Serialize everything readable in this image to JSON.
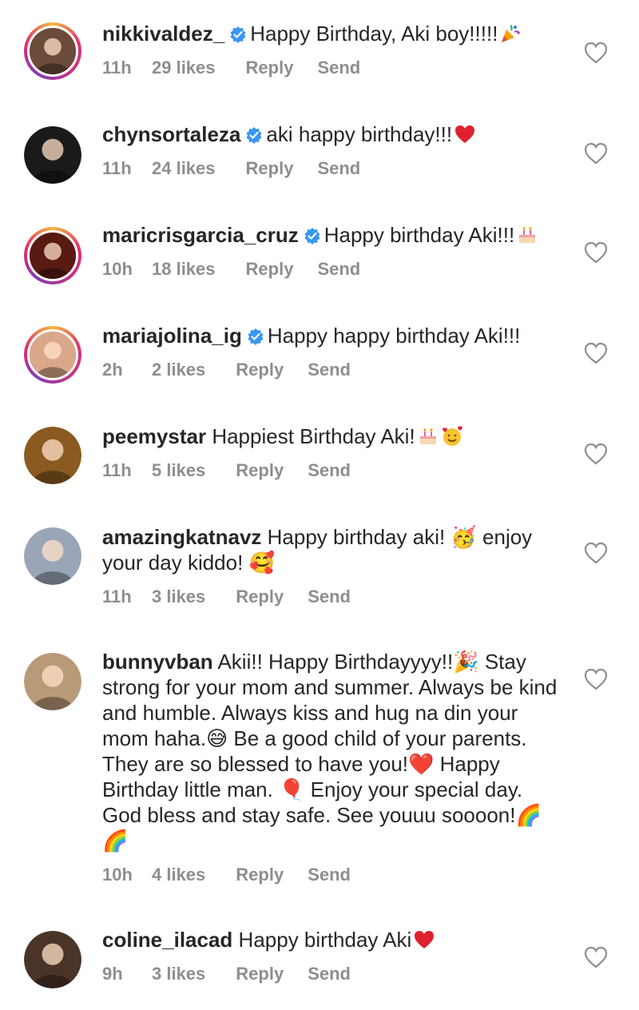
{
  "comments": [
    {
      "username": "nikkivaldez_",
      "verified": true,
      "text": "Happy Birthday, Aki boy!!!!!",
      "emoji": [
        "party-popper"
      ],
      "time": "11h",
      "likes": "29 likes",
      "reply": "Reply",
      "send": "Send",
      "story_ring": true,
      "avatar_color": "#6b4b3a"
    },
    {
      "username": "chynsortaleza",
      "verified": true,
      "text": "aki happy birthday!!!",
      "emoji": [
        "red-heart"
      ],
      "time": "11h",
      "likes": "24 likes",
      "reply": "Reply",
      "send": "Send",
      "story_ring": false,
      "avatar_color": "#1a1a1a"
    },
    {
      "username": "maricrisgarcia_cruz",
      "verified": true,
      "text": "Happy birthday Aki!!!",
      "emoji": [
        "birthday-cake"
      ],
      "time": "10h",
      "likes": "18 likes",
      "reply": "Reply",
      "send": "Send",
      "story_ring": true,
      "avatar_color": "#5a1a14"
    },
    {
      "username": "mariajolina_ig",
      "verified": true,
      "text": "Happy happy birthday Aki!!!",
      "emoji": [],
      "time": "2h",
      "likes": "2 likes",
      "reply": "Reply",
      "send": "Send",
      "story_ring": true,
      "avatar_color": "#d9a88a"
    },
    {
      "username": "peemystar",
      "verified": false,
      "text": "Happiest Birthday Aki!",
      "emoji": [
        "birthday-cake",
        "smiling-face-with-hearts"
      ],
      "time": "11h",
      "likes": "5 likes",
      "reply": "Reply",
      "send": "Send",
      "story_ring": false,
      "avatar_color": "#8a5a20"
    },
    {
      "username": "amazingkatnavz",
      "verified": false,
      "text": "Happy birthday aki! 🥳 enjoy your day kiddo! 🥰",
      "emoji": [],
      "time": "11h",
      "likes": "3 likes",
      "reply": "Reply",
      "send": "Send",
      "story_ring": false,
      "avatar_color": "#9aa6b8"
    },
    {
      "username": "bunnyvban",
      "verified": false,
      "text": "Akii!! Happy Birthdayyyy!!🎉 Stay strong for your mom and summer. Always be kind and humble. Always kiss and hug na din your mom haha.😅 Be a good child of your parents. They are so blessed to have you!❤️ Happy Birthday little man. 🎈 Enjoy your special day. God bless and stay safe. See youuu soooon!🌈🌈",
      "emoji": [],
      "time": "10h",
      "likes": "4 likes",
      "reply": "Reply",
      "send": "Send",
      "story_ring": false,
      "avatar_color": "#b89a78"
    },
    {
      "username": "coline_ilacad",
      "verified": false,
      "text": "Happy birthday Aki",
      "emoji": [
        "red-heart"
      ],
      "time": "9h",
      "likes": "3 likes",
      "reply": "Reply",
      "send": "Send",
      "story_ring": false,
      "avatar_color": "#4a3428"
    }
  ],
  "colors": {
    "verified": "#3897f0",
    "meta_text": "#8e8e8e",
    "text": "#262626",
    "heart_outline": "#8e8e8e"
  }
}
